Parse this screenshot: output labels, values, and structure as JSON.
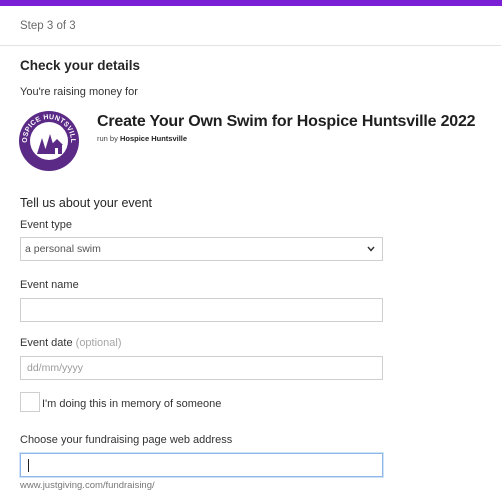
{
  "step": "Step 3 of 3",
  "section_title": "Check your details",
  "raising_text": "You're raising money for",
  "campaign": {
    "title": "Create Your Own Swim for Hospice Huntsville 2022",
    "run_by_prefix": "run by",
    "run_by_name": "Hospice Huntsville",
    "logo_text": "HOSPICE HUNTSVILLE"
  },
  "event_section_title": "Tell us about your event",
  "event_type": {
    "label": "Event type",
    "value": "a personal swim"
  },
  "event_name": {
    "label": "Event name",
    "value": ""
  },
  "event_date": {
    "label": "Event date",
    "optional": "(optional)",
    "placeholder": "dd/mm/yyyy"
  },
  "memory_checkbox": {
    "label": "I'm doing this in memory of someone",
    "checked": false
  },
  "web_address": {
    "label": "Choose your fundraising page web address",
    "value": "",
    "hint": "www.justgiving.com/fundraising/"
  },
  "colors": {
    "accent": "#7b1fd6",
    "logo": "#5b2a86"
  }
}
